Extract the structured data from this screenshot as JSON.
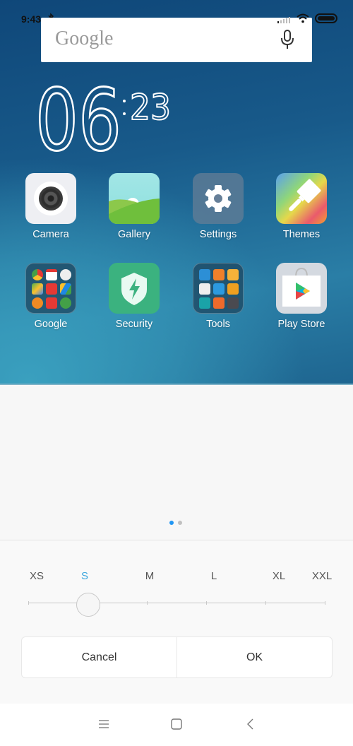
{
  "status_bar": {
    "time": "9:43",
    "icons": [
      "bluetooth-icon",
      "signal-icon",
      "wifi-icon",
      "battery-icon"
    ]
  },
  "search_widget": {
    "logo_text": "Google",
    "mic_icon": "mic-icon"
  },
  "clock_widget": {
    "hour": "06",
    "minute": "23"
  },
  "apps": [
    {
      "label": "Camera",
      "icon": "camera-icon"
    },
    {
      "label": "Gallery",
      "icon": "gallery-icon"
    },
    {
      "label": "Settings",
      "icon": "gear-icon"
    },
    {
      "label": "Themes",
      "icon": "paintbrush-icon"
    },
    {
      "label": "Google",
      "icon": "google-folder-icon"
    },
    {
      "label": "Security",
      "icon": "shield-bolt-icon"
    },
    {
      "label": "Tools",
      "icon": "tools-folder-icon"
    },
    {
      "label": "Play Store",
      "icon": "play-store-icon"
    }
  ],
  "page_indicator": {
    "pages": 2,
    "active_index": 0,
    "active_color": "#2196f3",
    "inactive_color": "#c0c0c0"
  },
  "icon_size_sheet": {
    "options": [
      "XS",
      "S",
      "M",
      "L",
      "XL",
      "XXL"
    ],
    "selected": "S",
    "selected_index": 1,
    "selected_color": "#3aa6dd",
    "cancel_label": "Cancel",
    "ok_label": "OK"
  },
  "nav_bar": {
    "buttons": [
      "menu-icon",
      "home-icon",
      "back-icon"
    ]
  }
}
